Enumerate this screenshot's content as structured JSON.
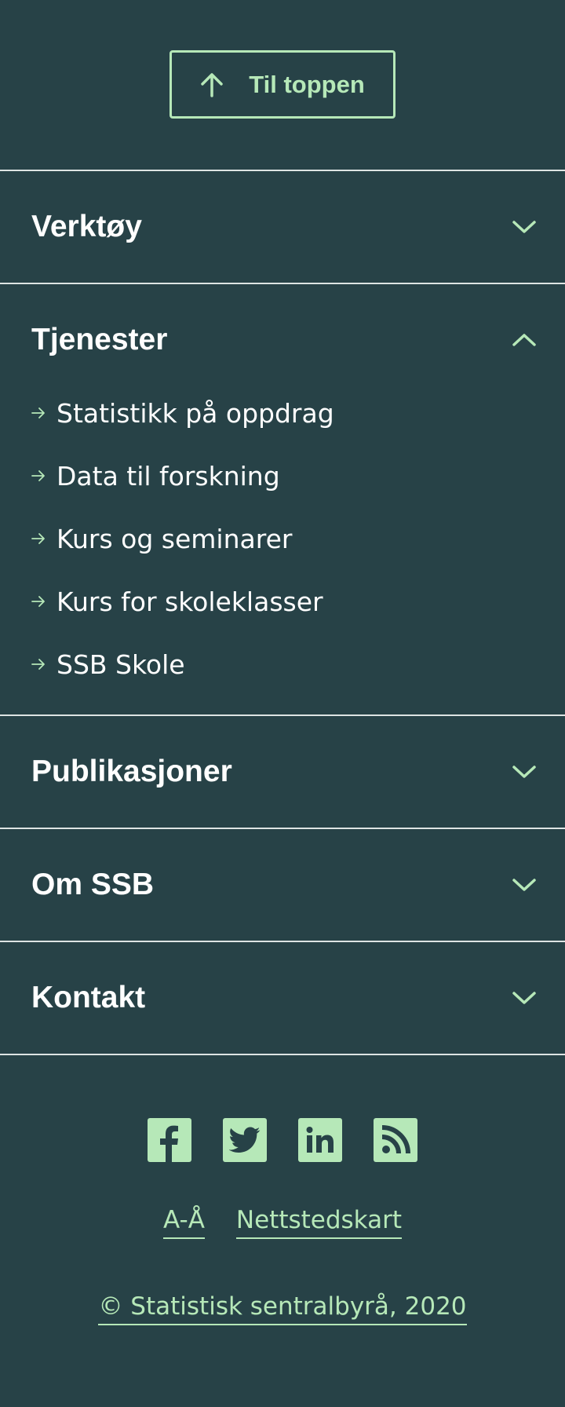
{
  "to_top": {
    "label": "Til toppen",
    "icon": "arrow-up-icon"
  },
  "sections": [
    {
      "title": "Verktøy",
      "expanded": false
    },
    {
      "title": "Tjenester",
      "expanded": true,
      "links": [
        "Statistikk på oppdrag",
        "Data til forskning",
        "Kurs og seminarer",
        "Kurs for skoleklasser",
        "SSB Skole"
      ]
    },
    {
      "title": "Publikasjoner",
      "expanded": false
    },
    {
      "title": "Om SSB",
      "expanded": false
    },
    {
      "title": "Kontakt",
      "expanded": false
    }
  ],
  "social": [
    "facebook-icon",
    "twitter-icon",
    "linkedin-icon",
    "rss-icon"
  ],
  "bottom_links": {
    "a_z": "A-Å",
    "sitemap": "Nettstedskart"
  },
  "copyright": "© Statistisk sentralbyrå, 2020",
  "colors": {
    "background": "#274247",
    "accent": "#b6e8b8",
    "divider": "#dde4e3"
  }
}
